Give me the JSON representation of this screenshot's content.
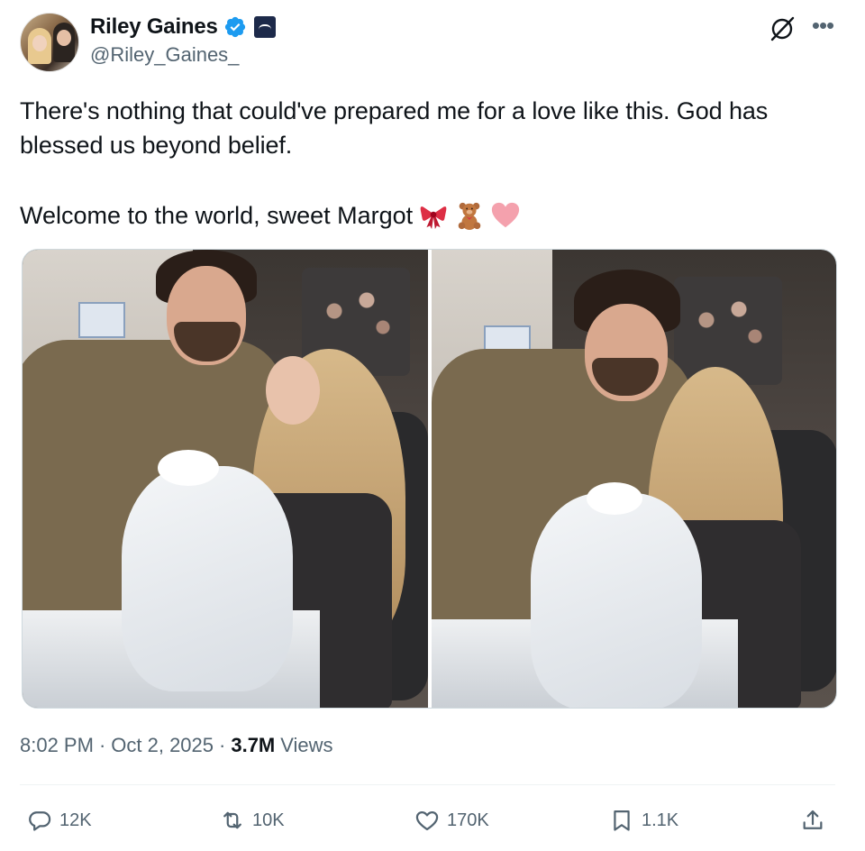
{
  "author": {
    "name": "Riley Gaines",
    "handle": "@Riley_Gaines_",
    "verified": true,
    "verified_color": "#1d9bf0"
  },
  "header_icons": [
    "grok-icon",
    "more-icon"
  ],
  "tweet": {
    "text": "There's nothing that could've prepared me for a love like this. God has blessed us beyond belief.",
    "line2": "Welcome to the world, sweet Margot",
    "emojis": [
      "ribbon-emoji",
      "teddy-bear-emoji",
      "heart-emoji"
    ]
  },
  "meta": {
    "time": "8:02 PM",
    "separator": "·",
    "date": "Oct 2, 2025",
    "views_count": "3.7M",
    "views_label": "Views"
  },
  "actions": {
    "replies": "12K",
    "reposts": "10K",
    "likes": "170K",
    "bookmarks": "1.1K"
  },
  "colors": {
    "text": "#0f1419",
    "secondary": "#536471",
    "border": "#cfd9de",
    "accent": "#1d9bf0"
  }
}
